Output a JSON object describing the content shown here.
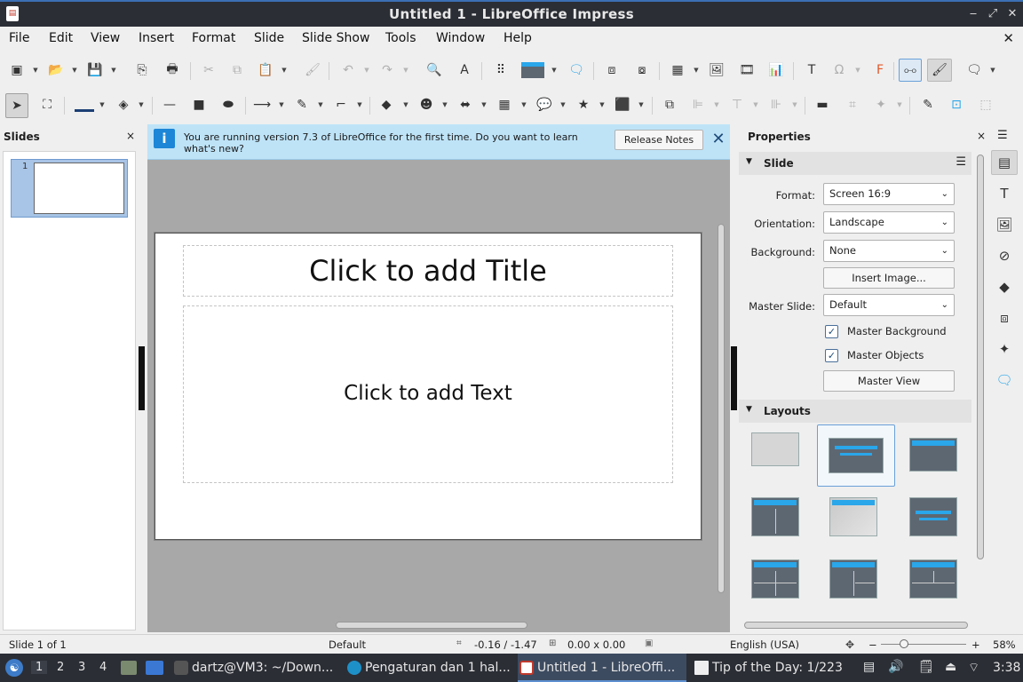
{
  "window": {
    "title": "Untitled 1 - LibreOffice Impress",
    "minimize": "‒",
    "restore": "⤢",
    "close": "✕"
  },
  "menu": {
    "items": [
      "File",
      "Edit",
      "View",
      "Insert",
      "Format",
      "Slide",
      "Slide Show",
      "Tools",
      "Window",
      "Help"
    ],
    "close": "✕"
  },
  "slides_pane": {
    "title": "Slides",
    "close": "×",
    "thumb_number": "1"
  },
  "infobar": {
    "icon": "i",
    "message": "You are running version 7.3 of LibreOffice for the first time. Do you want to learn what's new?",
    "button": "Release Notes",
    "close": "✕"
  },
  "slide": {
    "title_placeholder": "Click to add Title",
    "content_placeholder": "Click to add Text"
  },
  "properties": {
    "title": "Properties",
    "close": "×",
    "slide_section": "Slide",
    "format_label": "Format:",
    "format_value": "Screen 16:9",
    "orientation_label": "Orientation:",
    "orientation_value": "Landscape",
    "background_label": "Background:",
    "background_value": "None",
    "insert_image": "Insert Image...",
    "master_slide_label": "Master Slide:",
    "master_slide_value": "Default",
    "master_background": "Master Background",
    "master_objects": "Master Objects",
    "master_view": "Master View",
    "layouts_section": "Layouts",
    "check_mark": "✓"
  },
  "statusbar": {
    "slide": "Slide 1 of 1",
    "master": "Default",
    "position": "-0.16 / -1.47",
    "size": "0.00 x 0.00",
    "language": "English (USA)",
    "zoom": "58%",
    "zoom_minus": "−",
    "zoom_plus": "+"
  },
  "taskbar": {
    "workspaces": [
      "1",
      "2",
      "3",
      "4"
    ],
    "tasks": [
      "dartz@VM3: ~/Down...",
      "Pengaturan dan 1 hal...",
      "Untitled 1 - LibreOffi...",
      "Tip of the Day: 1/223"
    ],
    "clock": "3:38"
  },
  "colors": {
    "accent": "#2aa6ea",
    "infobar": "#bee3f7",
    "titlebar": "#2b2e35"
  }
}
